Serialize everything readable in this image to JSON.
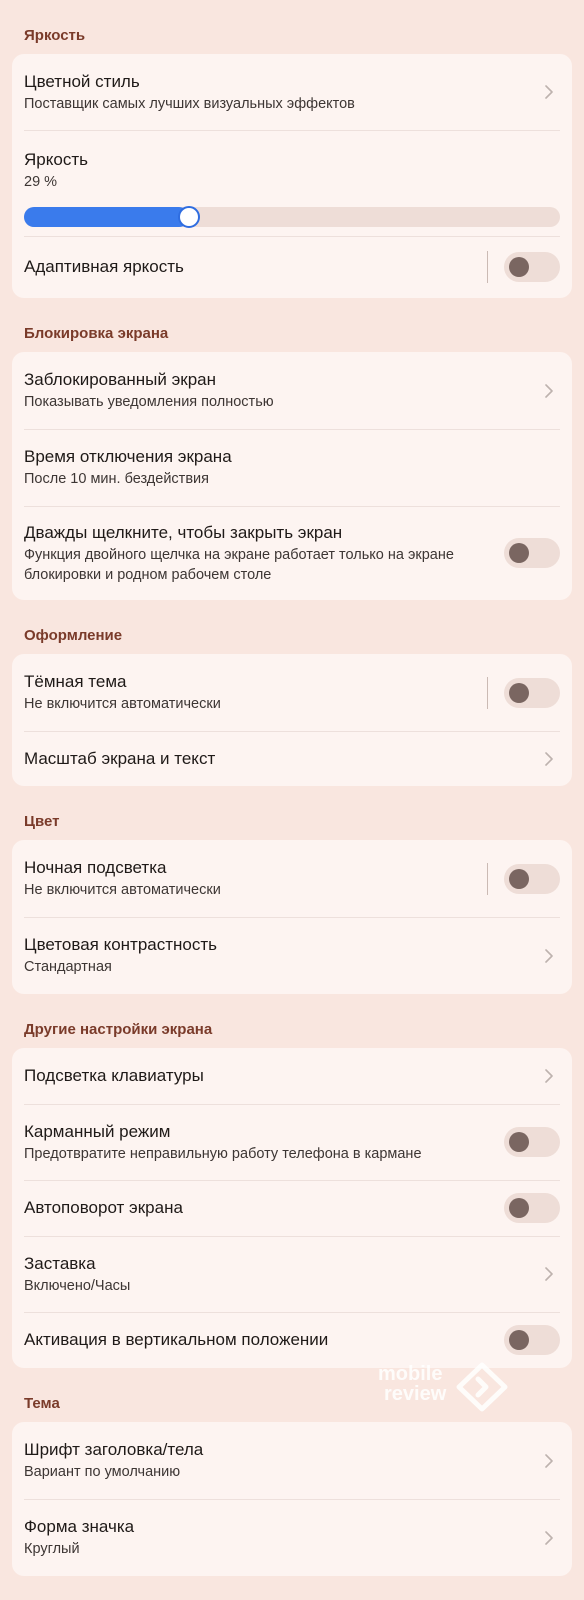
{
  "sections": {
    "brightness": {
      "header": "Яркость",
      "color_style": {
        "title": "Цветной стиль",
        "subtitle": "Поставщик самых лучших визуальных эффектов"
      },
      "brightness": {
        "title": "Яркость",
        "value_text": "29 %",
        "level": 0.29
      },
      "adaptive": {
        "title": "Адаптивная яркость",
        "on": false
      }
    },
    "lock": {
      "header": "Блокировка экрана",
      "locked_screen": {
        "title": "Заблокированный экран",
        "subtitle": "Показывать уведомления полностью"
      },
      "timeout": {
        "title": "Время отключения экрана",
        "subtitle": "После 10 мин. бездействия"
      },
      "double_tap": {
        "title": "Дважды щелкните, чтобы закрыть экран",
        "subtitle": "Функция двойного щелчка на экране работает только на экране блокировки и родном рабочем столе",
        "on": false
      }
    },
    "appearance": {
      "header": "Оформление",
      "dark_theme": {
        "title": "Тёмная тема",
        "subtitle": "Не включится автоматически",
        "on": false
      },
      "scale": {
        "title": "Масштаб экрана и текст"
      }
    },
    "color": {
      "header": "Цвет",
      "night_light": {
        "title": "Ночная подсветка",
        "subtitle": "Не включится автоматически",
        "on": false
      },
      "contrast": {
        "title": "Цветовая контрастность",
        "subtitle": "Стандартная"
      }
    },
    "other": {
      "header": "Другие настройки экрана",
      "keyboard_backlight": {
        "title": "Подсветка клавиатуры"
      },
      "pocket_mode": {
        "title": "Карманный режим",
        "subtitle": "Предотвратите неправильную работу телефона в кармане",
        "on": false
      },
      "auto_rotate": {
        "title": "Автоповорот экрана",
        "on": false
      },
      "screensaver": {
        "title": "Заставка",
        "subtitle": "Включено/Часы"
      },
      "raise_to_wake": {
        "title": "Активация в вертикальном положении",
        "on": false
      }
    },
    "theme": {
      "header": "Тема",
      "font": {
        "title": "Шрифт заголовка/тела",
        "subtitle": "Вариант по умолчанию"
      },
      "icon_shape": {
        "title": "Форма значка",
        "subtitle": "Круглый"
      }
    }
  },
  "watermark": {
    "line1": "mobile",
    "line2": "review"
  },
  "colors": {
    "accent": "#3a7bec",
    "background": "#f9e6df",
    "card": "#fdf4f1",
    "header_text": "#7a3b2a"
  },
  "icons": {
    "chevron": "chevron-right-icon"
  }
}
